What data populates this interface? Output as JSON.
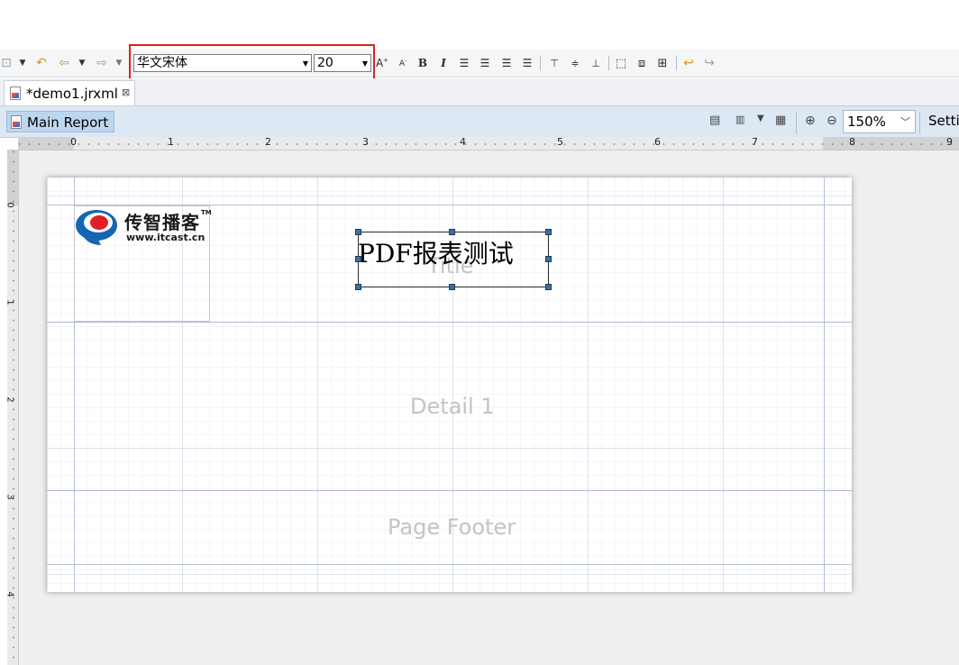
{
  "toolbar": {
    "font_name": "华文宋体",
    "font_size": "20",
    "buttons": [
      "back-nav-icon",
      "undo-icon",
      "back-arrow-icon",
      "forward-arrow-icon",
      "increase-font-icon",
      "decrease-font-icon",
      "bold-icon",
      "italic-icon",
      "align-left-icon",
      "align-center-icon",
      "align-right-icon",
      "align-justify-icon",
      "valign-top-icon",
      "valign-middle-icon",
      "valign-bottom-icon",
      "fit-width-icon",
      "fit-height-icon",
      "fit-both-icon",
      "undo-alt-icon",
      "redo-alt-icon"
    ]
  },
  "editor": {
    "tab_label": "*demo1.jrxml",
    "close_glyph": "⊠"
  },
  "report_toolbar": {
    "main_report_label": "Main Report",
    "zoom": "150%",
    "settings_label": "Setti"
  },
  "ruler": {
    "h_numbers": [
      "0",
      "1",
      "2",
      "3",
      "4",
      "5",
      "6",
      "7",
      "8",
      "9"
    ],
    "v_numbers": [
      "0",
      "1",
      "2",
      "3",
      "4"
    ]
  },
  "report": {
    "title_band": "Title",
    "detail_band": "Detail 1",
    "footer_band": "Page Footer",
    "logo_text": "传智播客",
    "logo_tm": "TM",
    "logo_url": "www.itcast.cn",
    "text_field": "PDF报表测试"
  },
  "colors": {
    "highlight": "#e02020",
    "handle": "#3d6ea0",
    "logo_red": "#e31e24",
    "logo_blue": "#1565b0"
  }
}
